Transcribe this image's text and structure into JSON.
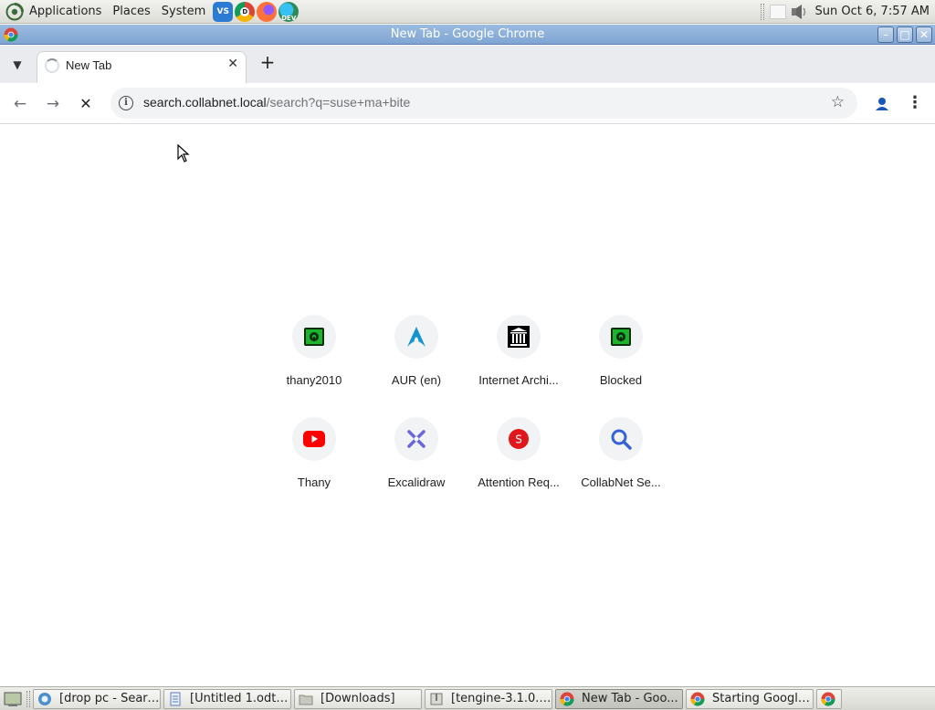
{
  "top_panel": {
    "menus": [
      "Applications",
      "Places",
      "System"
    ],
    "launchers": [
      {
        "icon": "vscode-icon",
        "color": "#2b7bd3"
      },
      {
        "icon": "chrome-dev-icon",
        "color": "#2d8f3c"
      },
      {
        "icon": "firefox-icon",
        "color": "#e8642a"
      },
      {
        "icon": "edge-dev-icon",
        "color": "#1b8bd2"
      }
    ],
    "clock": "Sun Oct  6,  7:57 AM"
  },
  "window": {
    "title": "New Tab - Google Chrome"
  },
  "browser": {
    "tab": {
      "title": "New Tab"
    },
    "url_host": "search.collabnet.local",
    "url_path": "/search?q=suse+ma+bite",
    "shortcuts": [
      {
        "label": "thany2010",
        "icon": "green-lock-icon"
      },
      {
        "label": "AUR (en)",
        "icon": "arch-linux-icon"
      },
      {
        "label": "Internet Archi...",
        "icon": "internet-archive-icon"
      },
      {
        "label": "Blocked",
        "icon": "green-lock-icon"
      },
      {
        "label": "Thany",
        "icon": "youtube-icon"
      },
      {
        "label": "Excalidraw",
        "icon": "excalidraw-icon"
      },
      {
        "label": "Attention Req...",
        "icon": "red-s-icon"
      },
      {
        "label": "CollabNet Se...",
        "icon": "search-magnifier-icon"
      }
    ]
  },
  "taskbar": {
    "tasks": [
      {
        "label": "[drop pc - Searc...",
        "icon": "web-browser-icon",
        "active": false
      },
      {
        "label": "[Untitled 1.odt ...",
        "icon": "document-icon",
        "active": false
      },
      {
        "label": "[Downloads]",
        "icon": "folder-icon",
        "active": false
      },
      {
        "label": "[tengine-3.1.0.t...",
        "icon": "archive-icon",
        "active": false
      },
      {
        "label": "New Tab - Goo...",
        "icon": "chrome-icon",
        "active": true
      },
      {
        "label": "Starting Google...",
        "icon": "chrome-icon",
        "active": false
      }
    ]
  }
}
